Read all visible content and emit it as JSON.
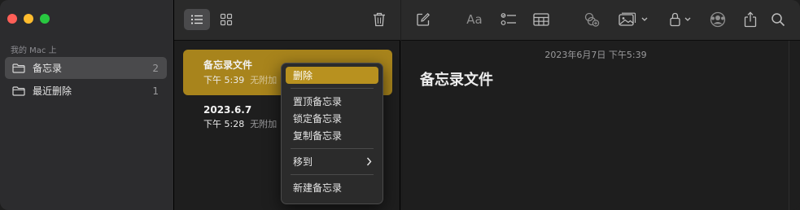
{
  "window": {
    "traffic_lights": [
      "#ff5f57",
      "#febc2e",
      "#28c840"
    ]
  },
  "sidebar": {
    "section_label": "我的 Mac 上",
    "folders": [
      {
        "label": "备忘录",
        "count": "2",
        "active": true
      },
      {
        "label": "最近删除",
        "count": "1",
        "active": false
      }
    ]
  },
  "notes_list": {
    "toolbar": {
      "list_view_icon": "list-icon",
      "gallery_view_icon": "grid-icon",
      "delete_icon": "trash-icon"
    },
    "notes": [
      {
        "title": "备忘录文件",
        "time": "下午 5:39",
        "attachment": "无附加",
        "selected": true
      },
      {
        "title": "2023.6.7",
        "time": "下午 5:28",
        "attachment": "无附加",
        "selected": false
      }
    ]
  },
  "editor": {
    "toolbar_icons": [
      "compose-icon",
      "format-text-icon",
      "checklist-icon",
      "table-icon",
      "collaborate-icon",
      "media-icon",
      "lock-icon",
      "share-people-icon",
      "share-icon",
      "search-icon"
    ],
    "format_label": "Aa",
    "date": "2023年6月7日 下午5:39",
    "title": "备忘录文件"
  },
  "context_menu": {
    "items": [
      {
        "label": "删除",
        "highlighted": true
      },
      {
        "label": "置顶备忘录"
      },
      {
        "label": "锁定备忘录"
      },
      {
        "label": "复制备忘录"
      },
      {
        "label": "移到",
        "submenu": true
      },
      {
        "label": "新建备忘录"
      }
    ]
  },
  "colors": {
    "accent": "#a8841c",
    "menu_highlight": "#b8911f",
    "background": "#1e1e1e",
    "sidebar": "#2c2c2e"
  }
}
